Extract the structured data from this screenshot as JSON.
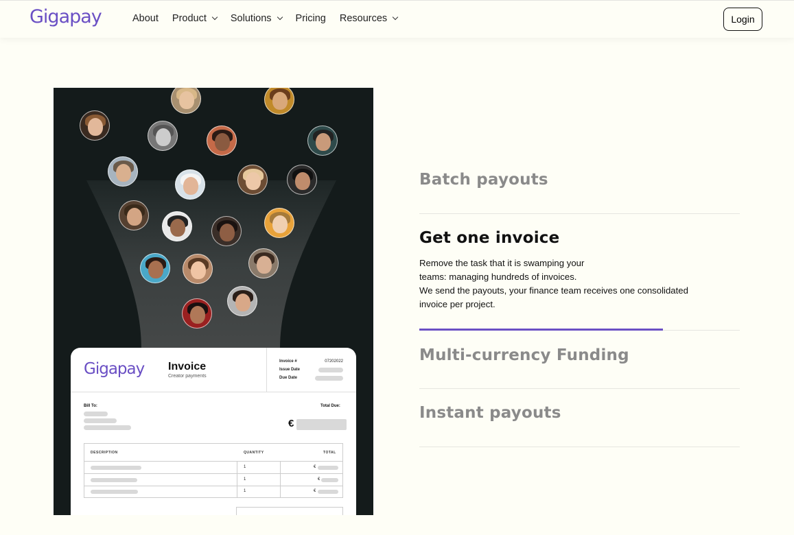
{
  "header": {
    "logo": "Gigapay",
    "nav": [
      {
        "label": "About",
        "dropdown": false
      },
      {
        "label": "Product",
        "dropdown": true
      },
      {
        "label": "Solutions",
        "dropdown": true
      },
      {
        "label": "Pricing",
        "dropdown": false
      },
      {
        "label": "Resources",
        "dropdown": true
      }
    ],
    "login_label": "Login"
  },
  "invoice": {
    "logo": "Gigapay",
    "title": "Invoice",
    "subtitle": "Creator payments",
    "invoice_no_label": "Invoice #",
    "invoice_no": "07202022",
    "issue_date_label": "Issue Date",
    "due_date_label": "Due Date",
    "bill_to_label": "Bill To:",
    "total_due_label": "Total Due:",
    "currency_symbol": "€",
    "columns": [
      "DESCRIPTION",
      "QUANTITY",
      "TOTAL"
    ],
    "rows": [
      {
        "quantity": "1",
        "total_symbol": "€"
      },
      {
        "quantity": "1",
        "total_symbol": "€"
      },
      {
        "quantity": "1",
        "total_symbol": "€"
      }
    ]
  },
  "features": {
    "items": [
      {
        "title": "Batch payouts",
        "active": false
      },
      {
        "title": "Get one invoice",
        "active": true
      },
      {
        "title": "Multi-currency Funding",
        "active": false
      },
      {
        "title": "Instant payouts",
        "active": false
      }
    ],
    "active_description_lines": [
      "Remove the task that it is swamping your",
      "teams: managing hundreds of invoices.",
      "We send the payouts, your finance team receives one consolidated",
      "invoice per project."
    ],
    "progress_fraction": 0.76
  },
  "colors": {
    "brand": "#6a4fc4",
    "background": "#fefef6",
    "panel": "#141b1b",
    "inactive_title": "#8a8a8a"
  }
}
